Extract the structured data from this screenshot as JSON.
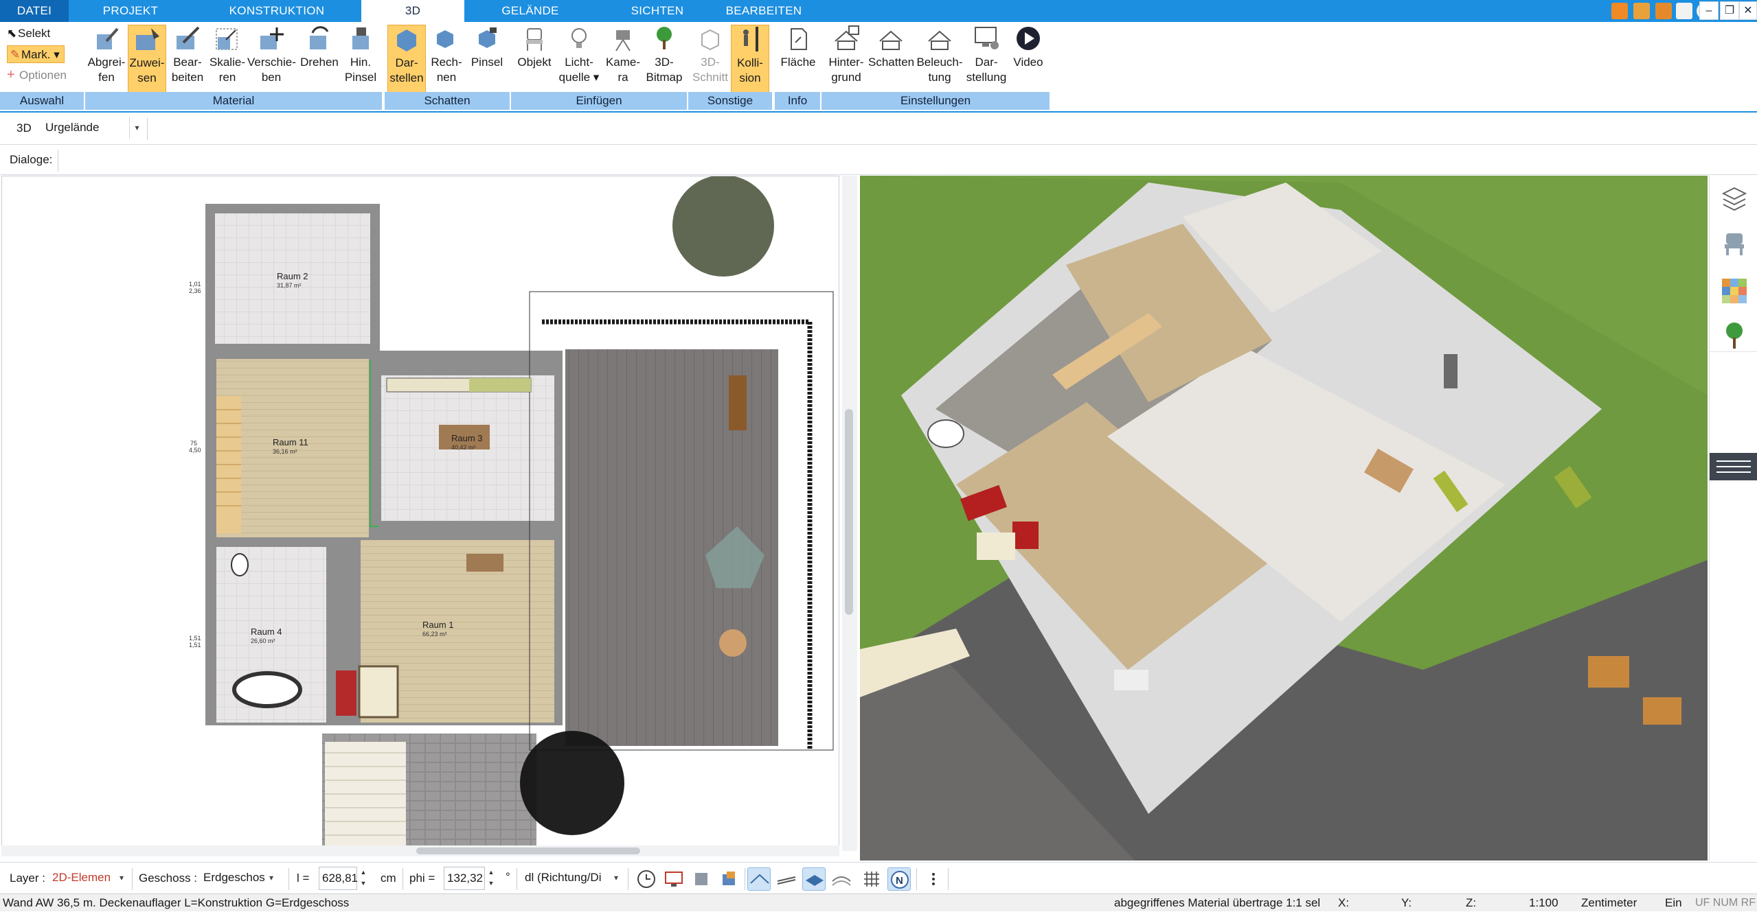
{
  "tabs": [
    "DATEI",
    "PROJEKT",
    "KONSTRUKTION",
    "3D",
    "GELÄNDE",
    "SICHTEN",
    "BEARBEITEN"
  ],
  "active_tab": "3D",
  "ribbon": {
    "auswahl": {
      "selekt": "Selekt",
      "mark": "Mark.",
      "optionen": "Optionen",
      "group": "Auswahl"
    },
    "material": {
      "group": "Material",
      "buttons": [
        {
          "l1": "Abgrei-",
          "l2": "fen"
        },
        {
          "l1": "Zuwei-",
          "l2": "sen"
        },
        {
          "l1": "Bear-",
          "l2": "beiten"
        },
        {
          "l1": "Skalie-",
          "l2": "ren"
        },
        {
          "l1": "Verschie-",
          "l2": "ben"
        },
        {
          "l1": "Drehen",
          "l2": ""
        },
        {
          "l1": "Hin.",
          "l2": "Pinsel"
        }
      ]
    },
    "schatten": {
      "group": "Schatten",
      "buttons": [
        {
          "l1": "Dar-",
          "l2": "stellen"
        },
        {
          "l1": "Rech-",
          "l2": "nen"
        },
        {
          "l1": "Pinsel",
          "l2": ""
        }
      ]
    },
    "einfuegen": {
      "group": "Einfügen",
      "buttons": [
        {
          "l1": "Objekt",
          "l2": ""
        },
        {
          "l1": "Licht-",
          "l2": "quelle"
        },
        {
          "l1": "Kame-",
          "l2": "ra"
        },
        {
          "l1": "3D-",
          "l2": "Bitmap"
        }
      ]
    },
    "sonstige": {
      "group": "Sonstige",
      "buttons": [
        {
          "l1": "3D-",
          "l2": "Schnitt"
        },
        {
          "l1": "Kolli-",
          "l2": "sion"
        }
      ]
    },
    "info": {
      "group": "Info",
      "buttons": [
        {
          "l1": "Fläche",
          "l2": ""
        }
      ]
    },
    "einstellungen": {
      "group": "Einstellungen",
      "buttons": [
        {
          "l1": "Hinter-",
          "l2": "grund"
        },
        {
          "l1": "Schatten",
          "l2": ""
        },
        {
          "l1": "Beleuch-",
          "l2": "tung"
        },
        {
          "l1": "Dar-",
          "l2": "stellung"
        },
        {
          "l1": "Video",
          "l2": ""
        }
      ]
    }
  },
  "toolbar3d": {
    "label": "3D",
    "select_value": "Urgelände"
  },
  "dialoge_label": "Dialoge:",
  "plan": {
    "rooms": [
      {
        "name": "Raum 2",
        "area": "31,87 m²"
      },
      {
        "name": "Raum 11",
        "area": "36,16 m²"
      },
      {
        "name": "Raum 3",
        "area": "40,42 m²"
      },
      {
        "name": "Raum 1",
        "area": "66,23 m²"
      },
      {
        "name": "Raum 4",
        "area": "26,60 m²"
      }
    ],
    "dims": [
      "1,01",
      "2,36",
      "1,51",
      "1,51",
      "75",
      "4,50"
    ]
  },
  "bottom": {
    "layer_label": "Layer :",
    "layer_value": "2D-Elemen",
    "geschoss_label": "Geschoss :",
    "geschoss_value": "Erdgeschos",
    "l_label": "l =",
    "l_value": "628,81",
    "l_unit": "cm",
    "phi_label": "phi =",
    "phi_value": "132,32",
    "phi_unit": "°",
    "dl_value": "dl (Richtung/Di"
  },
  "status": {
    "left": "Wand AW 36,5 m. Deckenauflager L=Konstruktion G=Erdgeschoss",
    "middle": "abgegriffenes Material übertrage 1:1 sel",
    "x": "X:",
    "y": "Y:",
    "z": "Z:",
    "scale": "1:100",
    "unit": "Zentimeter",
    "mode": "Ein",
    "flags": "UF NUM RF"
  },
  "colors": {
    "accent": "#1d8fe0",
    "ribbon_group": "#9cc9f2",
    "selected_button": "#ffcf6a",
    "lawn": "#6f9a3f",
    "wall": "#8e8e8e"
  },
  "icons": [
    "select-icon",
    "mark-icon",
    "options-icon",
    "layers-icon",
    "chair-icon",
    "material-palette-icon",
    "tree-icon",
    "menu-icon"
  ]
}
